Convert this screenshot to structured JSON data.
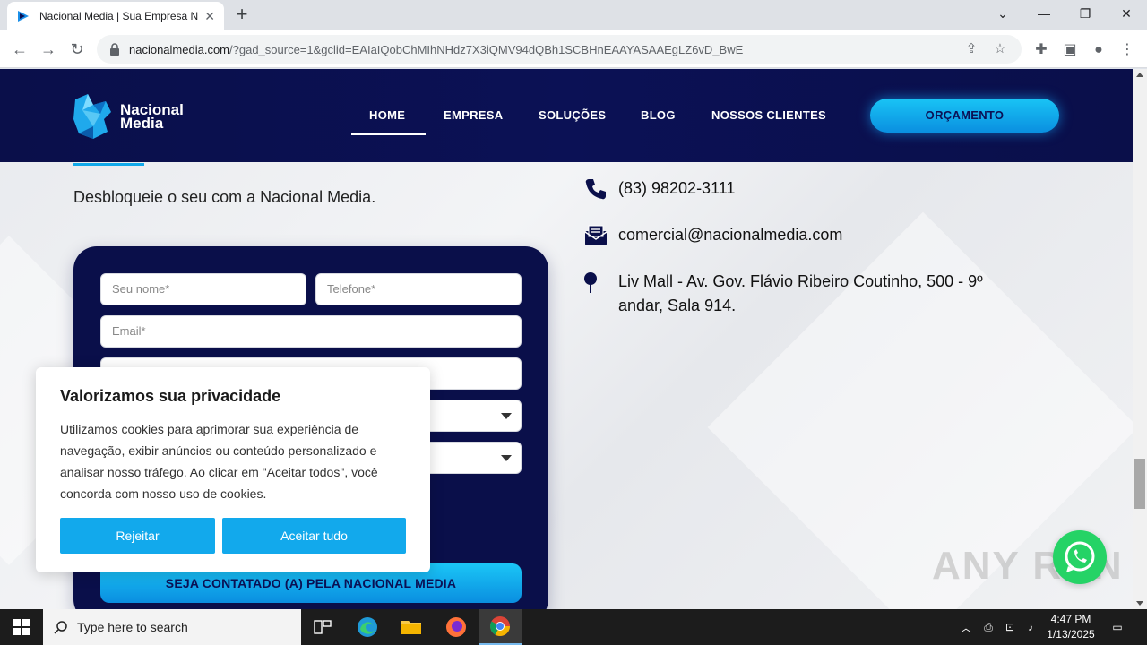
{
  "browser": {
    "tab_title": "Nacional Media | Sua Empresa N",
    "url_host": "nacionalmedia.com",
    "url_rest": "/?gad_source=1&gclid=EAIaIQobChMIhNHdz7X3iQMV94dQBh1SCBHnEAAYASAAEgLZ6vD_BwE"
  },
  "header": {
    "logo_line1": "Nacional",
    "logo_line2": "Media",
    "nav": [
      "HOME",
      "EMPRESA",
      "SOLUÇÕES",
      "BLOG",
      "NOSSOS CLIENTES"
    ],
    "cta_label": "ORÇAMENTO"
  },
  "content": {
    "subtitle": "Desbloqueie o seu com a Nacional Media."
  },
  "form": {
    "name_placeholder": "Seu nome*",
    "phone_placeholder": "Telefone*",
    "email_placeholder": "Email*",
    "submit_label": "SEJA CONTATADO (A) PELA NACIONAL MEDIA"
  },
  "contact": {
    "phone": "(83) 98202-3111",
    "email": "comercial@nacionalmedia.com",
    "address": "Liv Mall - Av. Gov. Flávio Ribeiro Coutinho, 500 - 9º andar, Sala 914."
  },
  "cookie": {
    "title": "Valorizamos sua privacidade",
    "text": "Utilizamos cookies para aprimorar sua experiência de navegação, exibir anúncios ou conteúdo personalizado e analisar nosso tráfego. Ao clicar em \"Aceitar todos\", você concorda com nosso uso de cookies.",
    "reject_label": "Rejeitar",
    "accept_label": "Aceitar tudo"
  },
  "watermark": "ANY RUN",
  "taskbar": {
    "search_placeholder": "Type here to search",
    "time": "4:47 PM",
    "date": "1/13/2025"
  },
  "colors": {
    "navy": "#0a0f4a",
    "cyan": "#12a9ec",
    "whatsapp": "#25d366"
  }
}
